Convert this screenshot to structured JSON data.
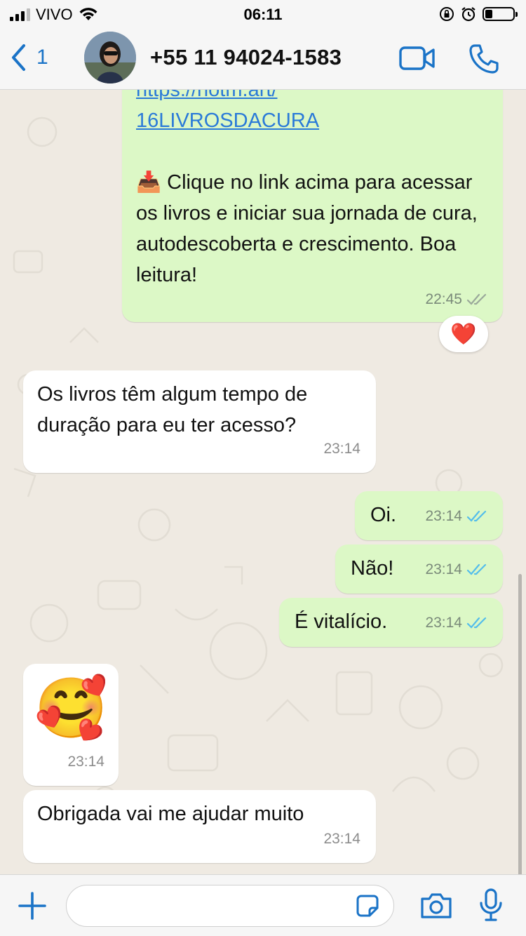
{
  "status_bar": {
    "carrier": "VIVO",
    "time": "06:11"
  },
  "header": {
    "back_count": "1",
    "contact_name": "+55 11 94024-1583"
  },
  "messages": {
    "m1": {
      "link_partial": "https://hotm.art/",
      "link_text": "16LIVROSDACURA",
      "emoji": "📥",
      "text": "Clique no link acima para acessar os livros e iniciar sua jornada de cura, autodescoberta e crescimento. Boa leitura!",
      "time": "22:45",
      "reaction": "❤️"
    },
    "m2": {
      "text": "Os livros têm algum tempo de duração para eu ter acesso?",
      "time": "23:14"
    },
    "m3": {
      "text": "Oi.",
      "time": "23:14"
    },
    "m4": {
      "text": "Não!",
      "time": "23:14"
    },
    "m5": {
      "text": "É vitalício.",
      "time": "23:14"
    },
    "m6": {
      "emoji": "🥰",
      "time": "23:14"
    },
    "m7": {
      "text": "Obrigada vai me ajudar muito",
      "time": "23:14"
    }
  },
  "colors": {
    "outgoing_bubble": "#dcf8c6",
    "incoming_bubble": "#ffffff",
    "accent": "#1a73c7",
    "read_ticks": "#53bdeb",
    "chat_background": "#efeae2"
  },
  "icons": [
    "back-chevron-icon",
    "video-call-icon",
    "voice-call-icon",
    "plus-icon",
    "sticker-icon",
    "camera-icon",
    "microphone-icon",
    "double-check-icon"
  ]
}
